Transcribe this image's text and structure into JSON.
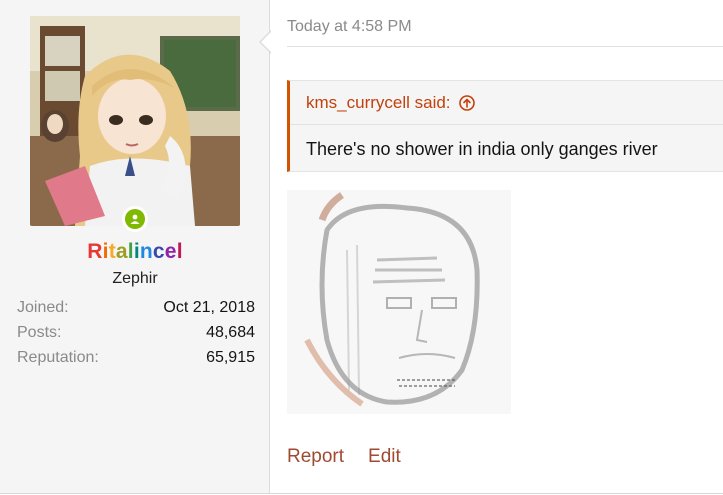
{
  "user": {
    "username": "Ritalincel",
    "username_letters": [
      "R",
      "i",
      "t",
      "a",
      "l",
      "i",
      "n",
      "c",
      "e",
      "l"
    ],
    "username_colors": [
      "#e53935",
      "#ef6c00",
      "#f9a825",
      "#9e9d24",
      "#43a047",
      "#00897b",
      "#1e88e5",
      "#3949ab",
      "#8e24aa",
      "#c2185b"
    ],
    "title": "Zephir",
    "online": true,
    "stats": [
      {
        "label": "Joined:",
        "value": "Oct 21, 2018"
      },
      {
        "label": "Posts:",
        "value": "48,684"
      },
      {
        "label": "Reputation:",
        "value": "65,915"
      }
    ]
  },
  "post": {
    "timestamp": "Today at 4:58 PM",
    "quote": {
      "author_said": "kms_currycell said:",
      "text": "There's no shower in india only ganges river"
    },
    "actions": {
      "report": "Report",
      "edit": "Edit"
    }
  },
  "colors": {
    "link": "#a04a32",
    "quote_accent": "#d35400",
    "online": "#7fb900"
  }
}
